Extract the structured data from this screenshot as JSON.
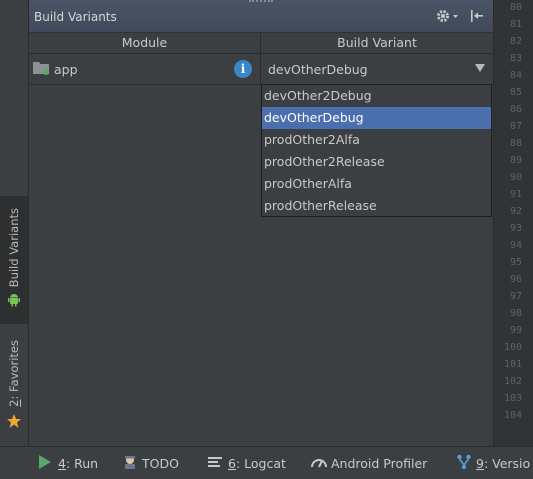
{
  "panel": {
    "title": "Build Variants",
    "columns": {
      "module": "Module",
      "variant": "Build Variant"
    }
  },
  "row": {
    "module": "app",
    "variant": "devOtherDebug"
  },
  "dropdown": {
    "options": [
      "devOther2Debug",
      "devOtherDebug",
      "prodOther2Alfa",
      "prodOther2Release",
      "prodOtherAlfa",
      "prodOtherRelease"
    ],
    "selected": "devOtherDebug"
  },
  "sidebar": {
    "tabs": [
      {
        "num": "",
        "label": "Build Variants"
      },
      {
        "num": "2",
        "label": ": Favorites"
      }
    ]
  },
  "gutter": {
    "line_numbers": [
      "80",
      "81",
      "82",
      "83",
      "84",
      "85",
      "86",
      "87",
      "88",
      "89",
      "90",
      "91",
      "92",
      "93",
      "94",
      "95",
      "96",
      "97",
      "98",
      "99",
      "100",
      "101",
      "102",
      "103",
      "104"
    ]
  },
  "bottom": {
    "run": {
      "num": "4",
      "label": ": Run"
    },
    "todo": {
      "label": "TODO"
    },
    "logcat": {
      "num": "6",
      "label": ": Logcat"
    },
    "profiler": {
      "label": "Android Profiler"
    },
    "version": {
      "num": "9",
      "label": ": Versio"
    }
  },
  "colors": {
    "selection": "#4b6eaf",
    "header": "#4a5467",
    "run_icon": "#59a869",
    "star": "#f0a732",
    "android": "#78c257"
  }
}
